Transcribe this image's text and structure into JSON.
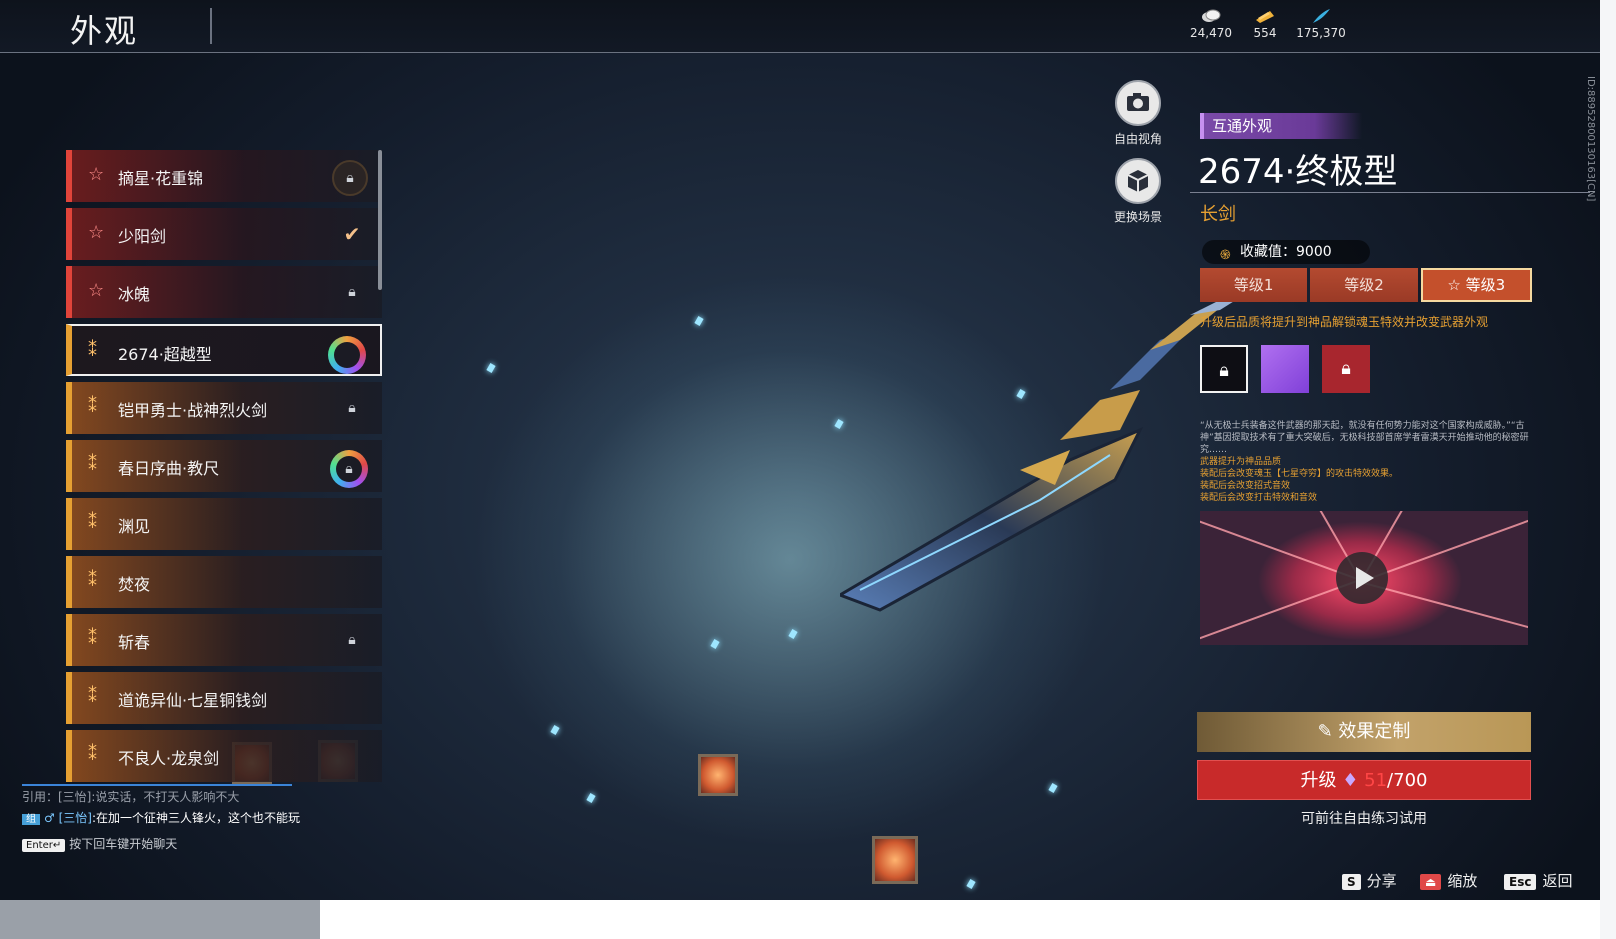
{
  "header": {
    "title": "外观"
  },
  "currencies": [
    {
      "icon": "coin-icon",
      "value": "24,470"
    },
    {
      "icon": "ticket-icon",
      "value": "554"
    },
    {
      "icon": "feather-icon",
      "value": "175,370"
    }
  ],
  "skins": [
    {
      "name": "摘星·花重锦",
      "tier": "red",
      "status": "lock-ring"
    },
    {
      "name": "少阳剑",
      "tier": "red",
      "status": "check"
    },
    {
      "name": "冰魄",
      "tier": "red",
      "status": "lock"
    },
    {
      "name": "2674·超越型",
      "tier": "gold",
      "status": "ring",
      "selected": true
    },
    {
      "name": "铠甲勇士·战神烈火剑",
      "tier": "gold",
      "status": "lock"
    },
    {
      "name": "春日序曲·教尺",
      "tier": "gold",
      "status": "lock-ring"
    },
    {
      "name": "渊见",
      "tier": "gold",
      "status": "none"
    },
    {
      "name": "焚夜",
      "tier": "gold",
      "status": "none"
    },
    {
      "name": "斩春",
      "tier": "gold",
      "status": "lock"
    },
    {
      "name": "道诡异仙·七星铜钱剑",
      "tier": "gold",
      "status": "none"
    },
    {
      "name": "不良人·龙泉剑",
      "tier": "gold",
      "status": "none"
    }
  ],
  "side_buttons": {
    "free_view": "自由视角",
    "change_scene": "更换场景"
  },
  "vertical_id": "ID:8895280013016​3[CN]",
  "detail": {
    "tag": "互通外观",
    "title": "2674·终极型",
    "weapon_type": "长剑",
    "collection": "收藏值：9000",
    "levels": [
      "等级1",
      "等级2",
      "等级3"
    ],
    "active_level": "等级3",
    "level_star": "☆",
    "upgrade_note": "升级后品质将提升到神品解锁魂玉特效并改变武器外观",
    "description": "“从无极士兵装备这件武器的那天起，就没有任何势力能对这个国家构成威胁。”“古神”基因提取技术有了重大突破后，无极科技部首席学者雷漠天开始推动他的秘密研究……",
    "notes": [
      "武器提升为神品品质",
      "装配后会改变魂玉【七星夺穷】的攻击特效效果。",
      "装配后会改变招式音效",
      "装配后会改变打击特效和音效"
    ],
    "custom_button": "效果定制",
    "upgrade_button": "升级",
    "upgrade_current": "51",
    "upgrade_total": "/700",
    "trial_text": "可前往自由练习试用"
  },
  "chat": {
    "cite": "引用：[三怡]:说实话，不打天人影响不大",
    "channel": "组",
    "gender": "♂",
    "name": "[三怡]",
    "message": ":在加一个征神三人锋火，这个也不能玩",
    "enter_key": "Enter↵",
    "enter_hint": "按下回车键开始聊天"
  },
  "hotkeys": [
    {
      "key": "S",
      "label": "分享"
    },
    {
      "key": "⏏",
      "label": "缩放"
    },
    {
      "key": "Esc",
      "label": "返回"
    }
  ],
  "colors": {
    "red_tier": "#e1443a",
    "gold_tier": "#e6a032",
    "upgrade": "#c82a2a",
    "tag": "#7a4aa8"
  }
}
